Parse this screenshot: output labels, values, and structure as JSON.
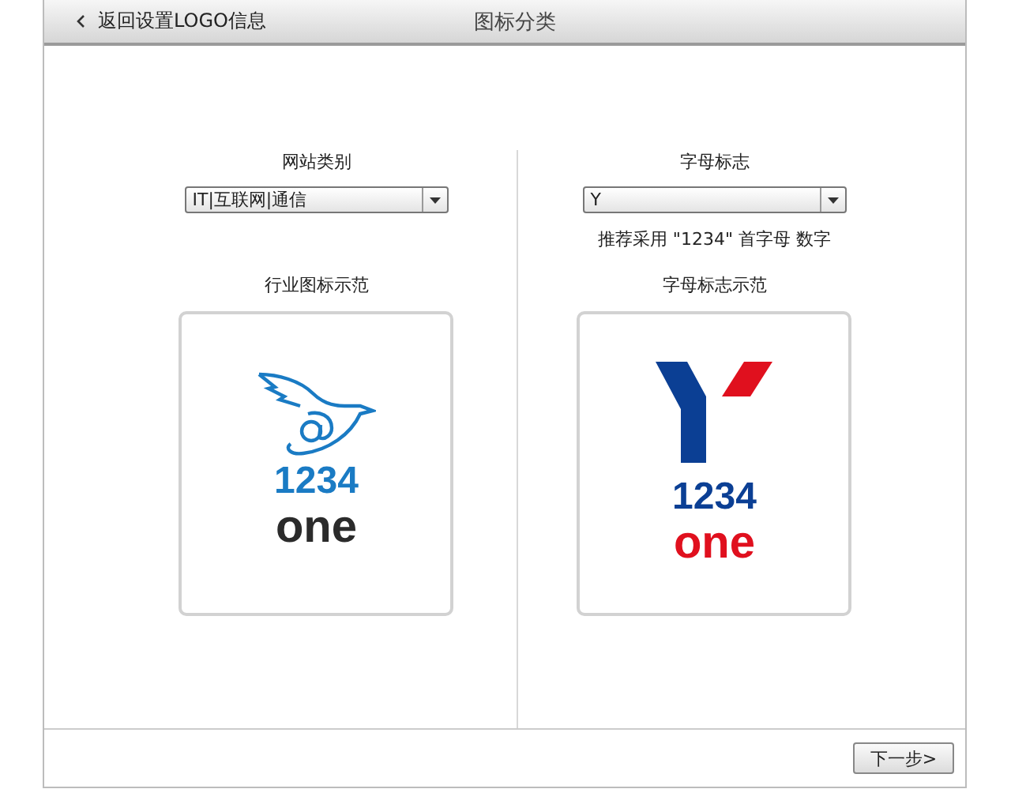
{
  "header": {
    "back_link": "返回设置LOGO信息",
    "title": "图标分类"
  },
  "columns": [
    {
      "label": "网站类别",
      "dropdown": {
        "value": "IT|互联网|通信"
      },
      "sample_label": "行业图标示范",
      "sample": {
        "kind": "bird",
        "line1": "1234",
        "line2": "one"
      }
    },
    {
      "label": "字母标志",
      "dropdown": {
        "value": "Y"
      },
      "hint": "推荐采用 \"1234\" 首字母 数字",
      "sample_label": "字母标志示范",
      "sample": {
        "kind": "letter",
        "line1": "1234",
        "line2": "one"
      }
    }
  ],
  "footer": {
    "next_button": "下一步>"
  }
}
